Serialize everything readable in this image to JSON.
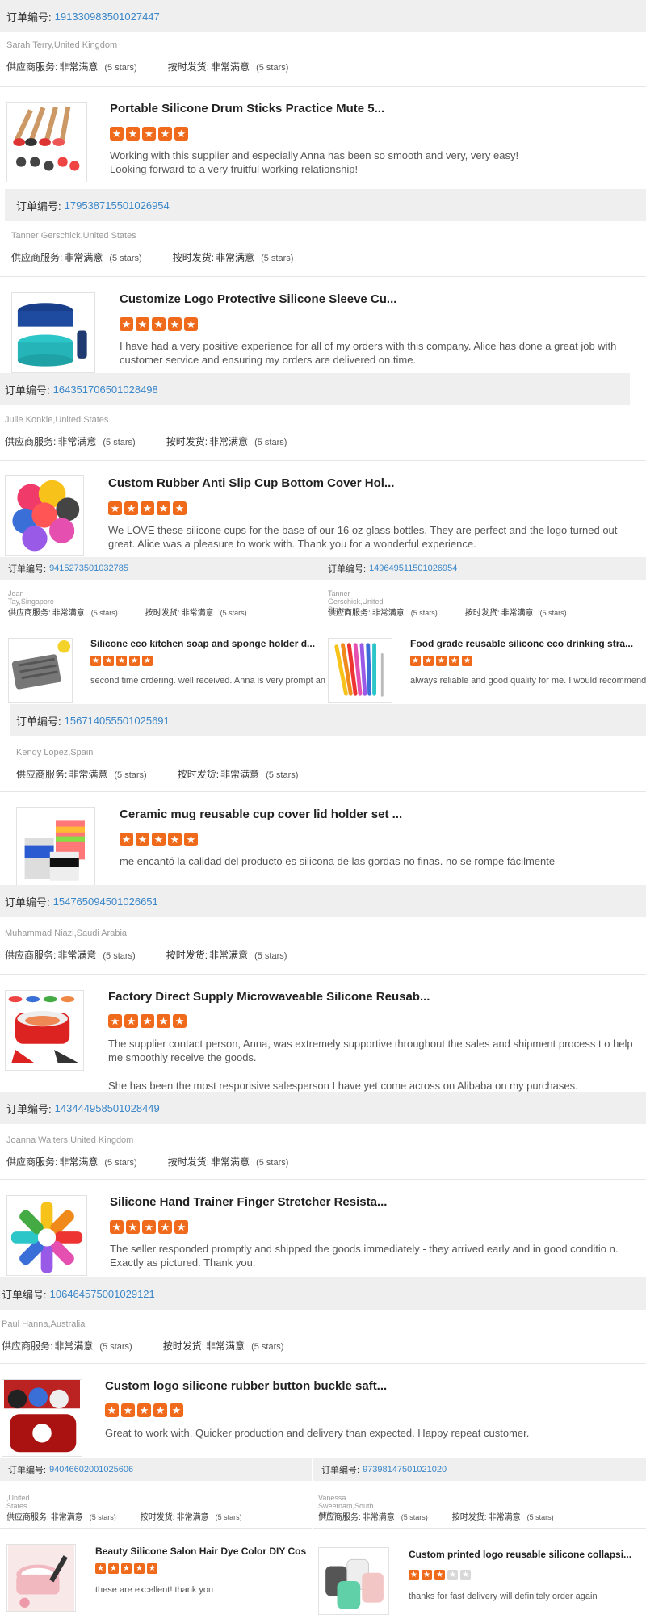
{
  "labels": {
    "order_no": "订单编号:",
    "supplier_service": "供应商服务:",
    "on_time_delivery": "按时发货:",
    "very_satisfied": "非常满意",
    "five_stars": "(5 stars)"
  },
  "reviews": [
    {
      "order": "191330983501027447",
      "customer": "Sarah Terry,United Kingdom",
      "product": "Portable Silicone Drum Sticks Practice Mute 5...",
      "rating": 5,
      "text": "Working with this supplier and especially Anna has been so smooth and very, very easy!\nLooking forward to a very fruitful working relationship!"
    },
    {
      "order": "179538715501026954",
      "customer": "Tanner Gerschick,United States",
      "product": "Customize Logo Protective Silicone Sleeve Cu...",
      "rating": 5,
      "text": "I have had a very positive experience for all of my orders with this company. Alice has done a great job with customer service and ensuring my orders are delivered on time."
    },
    {
      "order": "164351706501028498",
      "customer": "Julie Konkle,United States",
      "product": "Custom Rubber Anti Slip Cup Bottom Cover Hol...",
      "rating": 5,
      "text": "We LOVE these silicone cups for the base of our 16 oz glass bottles.  They are perfect and the logo turned out great.  Alice was a pleasure to work with.  Thank you for a wonderful experience."
    },
    {
      "order": "94152735010327​85",
      "customer": "Joan Tay,Singapore",
      "product": "Silicone eco kitchen soap and sponge holder d...",
      "rating": 5,
      "text": "second time ordering. well received. Anna is very prompt  and"
    },
    {
      "order": "149649511501026954",
      "customer": "Tanner Gerschick,United States",
      "product": "Food grade reusable silicone eco drinking stra...",
      "rating": 5,
      "text": "always reliable and good quality for me. I would recommend."
    },
    {
      "order": "156714055501025691",
      "customer": "Kendy Lopez,Spain",
      "product": "Ceramic mug reusable cup cover lid holder set ...",
      "rating": 5,
      "text": "me encantó la calidad del producto es silicona de las gordas no finas. no se rompe fácilmente"
    },
    {
      "order": "154765094501026651",
      "customer": "Muhammad Niazi,Saudi Arabia",
      "product": "Factory Direct Supply Microwaveable Silicone Reusab...",
      "rating": 5,
      "text": "The supplier contact person, Anna, was extremely supportive throughout the sales and shipment process t o help me smoothly receive the goods.",
      "text2": "She has been the most responsive salesperson I have yet come across on Alibaba on my purchases."
    },
    {
      "order": "143444958501028449",
      "customer": "Joanna Walters,United Kingdom",
      "product": "Silicone Hand Trainer Finger Stretcher Resista...",
      "rating": 5,
      "text": "The seller responded promptly and shipped the goods immediately - they arrived early and in good conditio n. Exactly as pictured. Thank you."
    },
    {
      "order": "106464575001029121",
      "customer": "Paul Hanna,Australia",
      "product": "Custom logo silicone rubber button buckle saft...",
      "rating": 5,
      "text": "Great to work with. Quicker production and delivery than expected. Happy repeat customer."
    },
    {
      "order": "94046602001025606",
      "customer": ",United States",
      "product": "Beauty Silicone Salon Hair Dye Color DIY Cos",
      "rating": 5,
      "text": "these are excellent! thank you"
    },
    {
      "order": "97398147501021020",
      "customer": "Vanessa Sweetnam,South Africa",
      "product": "Custom printed logo reusable silicone collapsi...",
      "rating": 3,
      "text": "thanks for fast delivery  will definitely order again"
    }
  ],
  "colors": {
    "accent_link": "#3a86c8",
    "star": "#f06a1c",
    "star_off": "#d8d8d8",
    "bar": "#efefef"
  }
}
